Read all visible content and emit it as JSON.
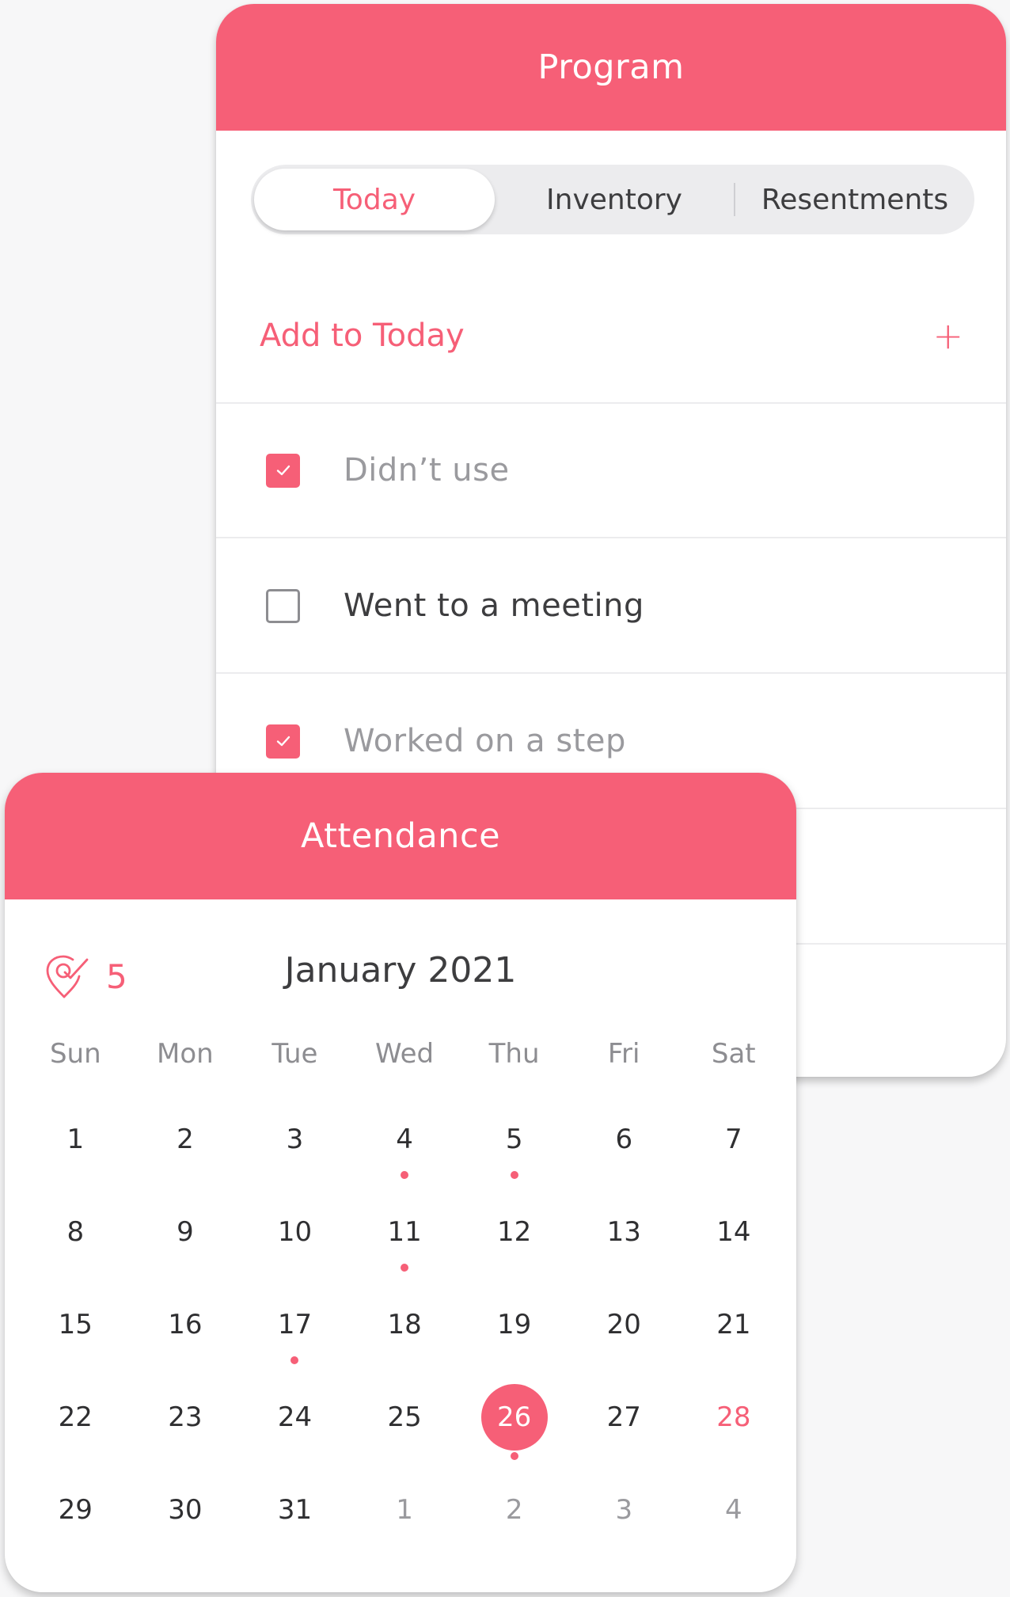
{
  "colors": {
    "accent": "#f65f77",
    "text": "#3d3d3f",
    "muted": "#9a9a9e"
  },
  "program": {
    "title": "Program",
    "tabs": [
      {
        "label": "Today",
        "active": true
      },
      {
        "label": "Inventory",
        "active": false
      },
      {
        "label": "Resentments",
        "active": false
      }
    ],
    "add_label": "Add to Today",
    "add_icon": "plus-icon",
    "tasks": [
      {
        "label": "Didn’t use",
        "checked": true
      },
      {
        "label": "Went to a meeting",
        "checked": false
      },
      {
        "label": "Worked on a step",
        "checked": true
      }
    ]
  },
  "attendance": {
    "title": "Attendance",
    "streak_icon": "location-check-icon",
    "streak_count": "5",
    "month": "January 2021",
    "weekdays": [
      "Sun",
      "Mon",
      "Tue",
      "Wed",
      "Thu",
      "Fri",
      "Sat"
    ],
    "days": [
      {
        "label": "1"
      },
      {
        "label": "2"
      },
      {
        "label": "3"
      },
      {
        "label": "4",
        "dot": true
      },
      {
        "label": "5",
        "dot": true
      },
      {
        "label": "6"
      },
      {
        "label": "7"
      },
      {
        "label": "8"
      },
      {
        "label": "9"
      },
      {
        "label": "10"
      },
      {
        "label": "11",
        "dot": true
      },
      {
        "label": "12"
      },
      {
        "label": "13"
      },
      {
        "label": "14"
      },
      {
        "label": "15"
      },
      {
        "label": "16"
      },
      {
        "label": "17",
        "dot": true
      },
      {
        "label": "18"
      },
      {
        "label": "19"
      },
      {
        "label": "20"
      },
      {
        "label": "21"
      },
      {
        "label": "22"
      },
      {
        "label": "23"
      },
      {
        "label": "24"
      },
      {
        "label": "25"
      },
      {
        "label": "26",
        "selected": true,
        "dot": true
      },
      {
        "label": "27"
      },
      {
        "label": "28",
        "highlight": true
      },
      {
        "label": "29"
      },
      {
        "label": "30"
      },
      {
        "label": "31"
      },
      {
        "label": "1",
        "other": true
      },
      {
        "label": "2",
        "other": true
      },
      {
        "label": "3",
        "other": true
      },
      {
        "label": "4",
        "other": true
      }
    ]
  }
}
